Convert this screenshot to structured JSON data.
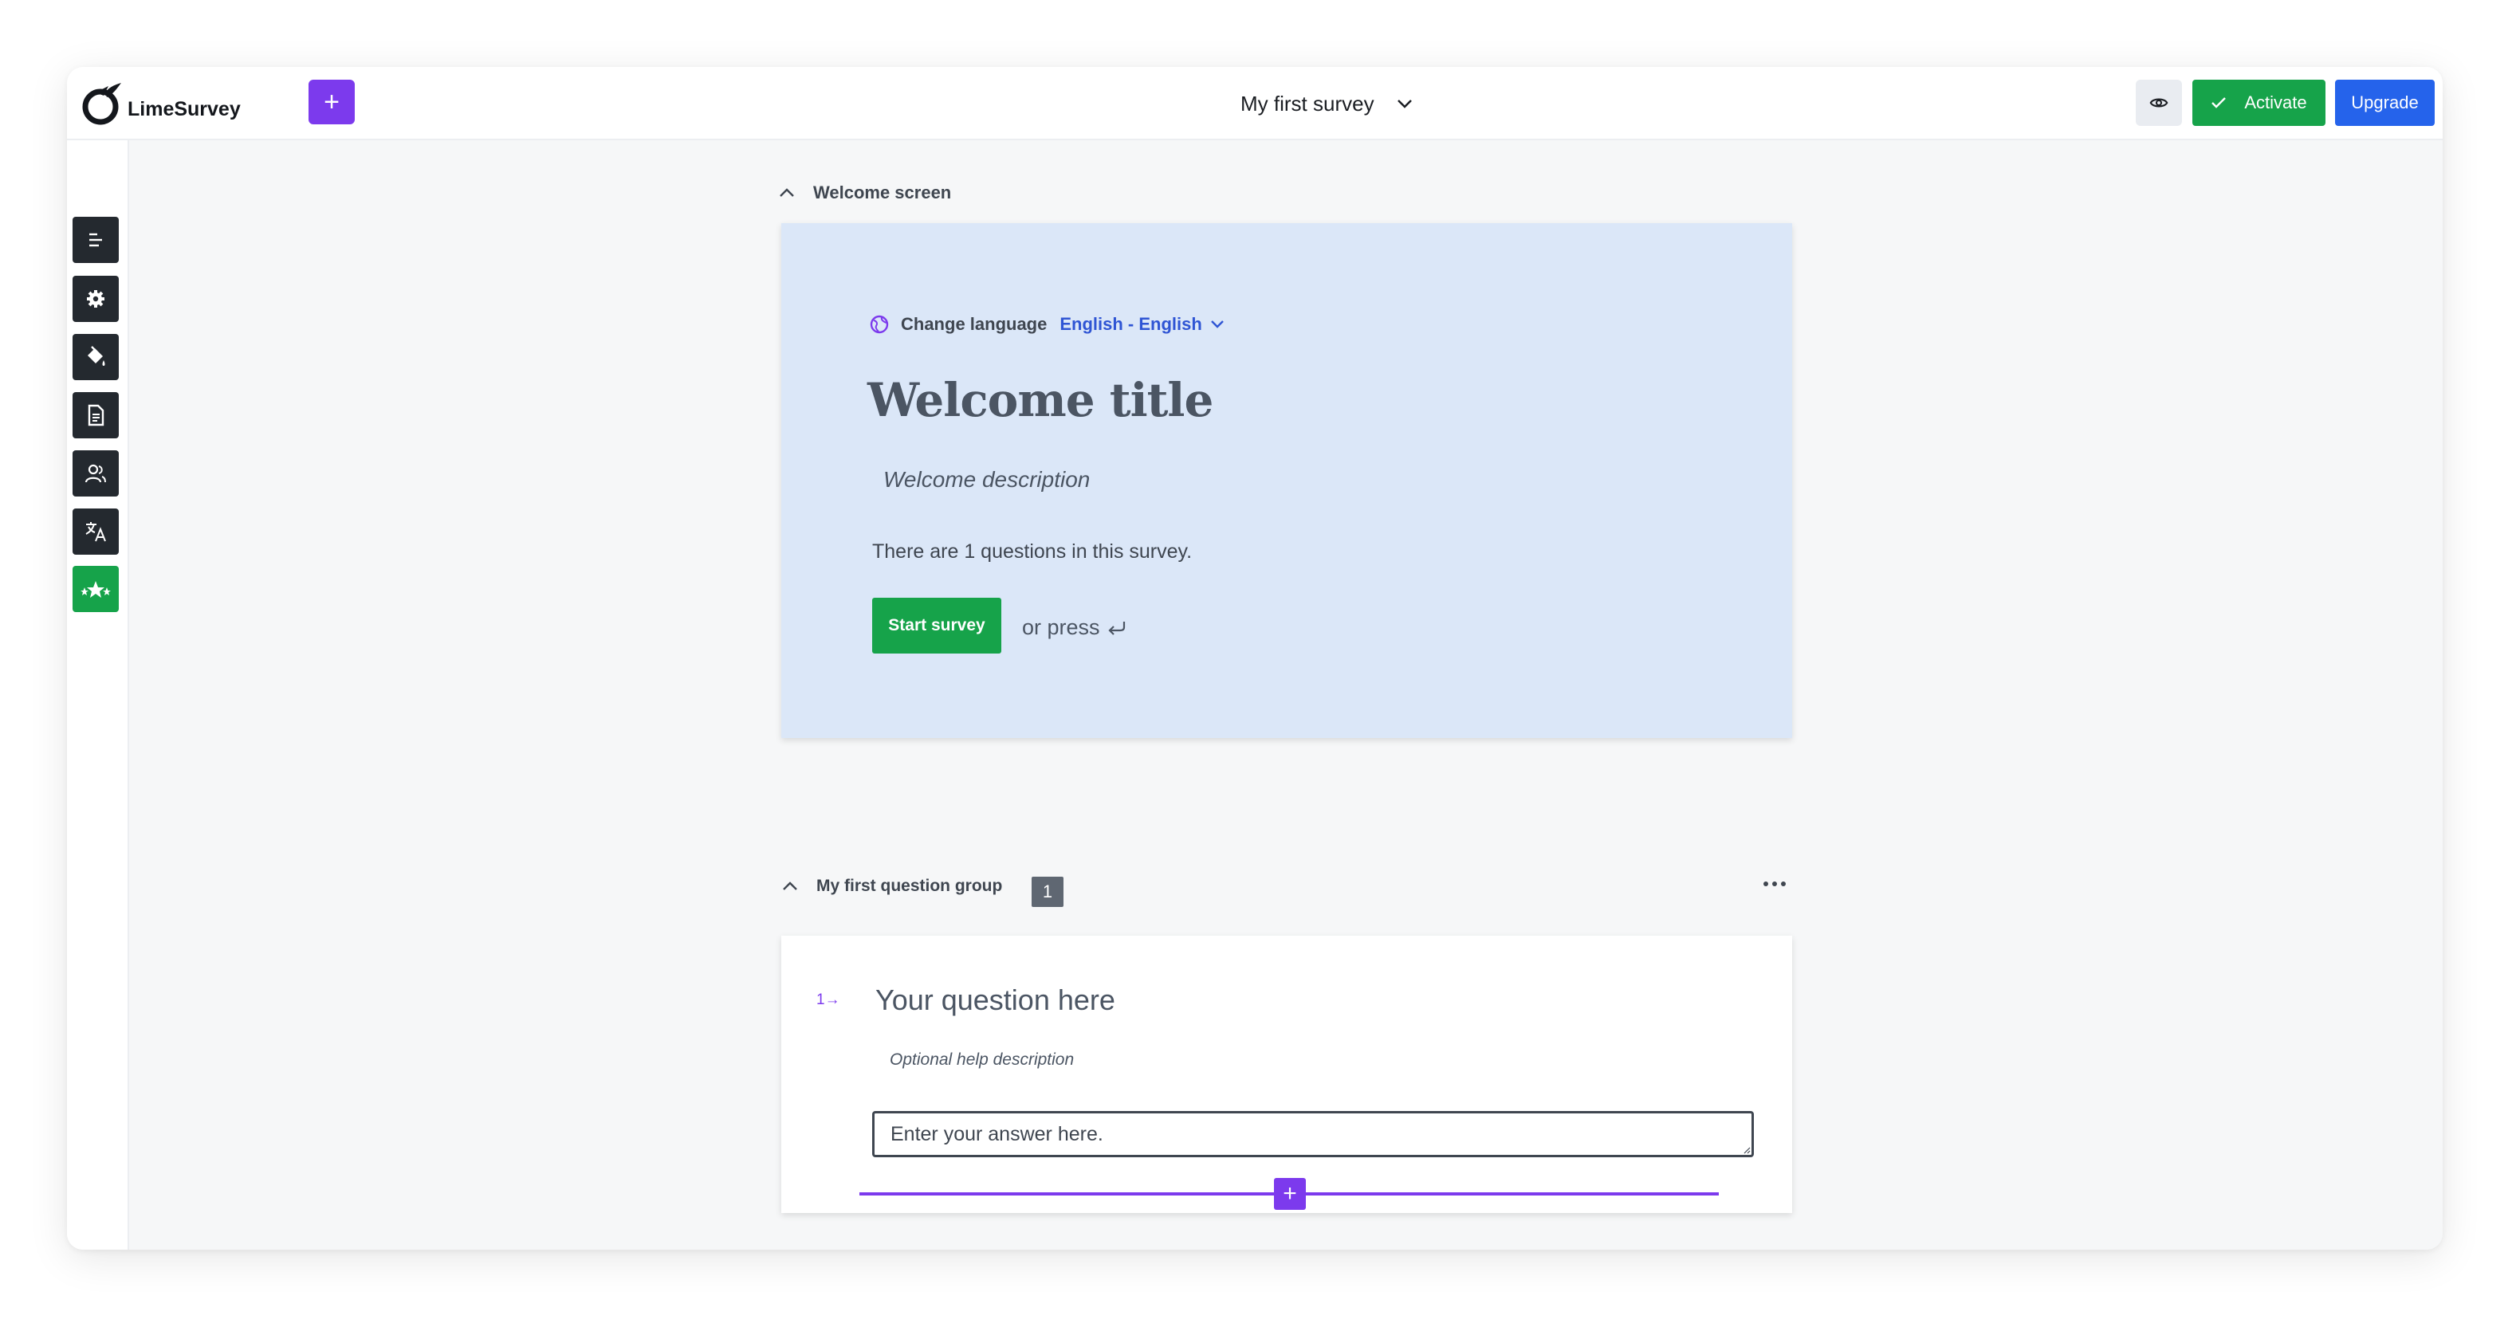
{
  "app": {
    "name": "LimeSurvey"
  },
  "header": {
    "add_button_label": "+",
    "survey_title": "My first survey",
    "activate_label": "Activate",
    "upgrade_label": "Upgrade"
  },
  "sidebar": {
    "items": [
      {
        "icon": "structure-icon"
      },
      {
        "icon": "settings-icon"
      },
      {
        "icon": "theme-icon"
      },
      {
        "icon": "document-icon"
      },
      {
        "icon": "participants-icon"
      },
      {
        "icon": "translate-icon"
      },
      {
        "icon": "rating-stars-icon"
      }
    ]
  },
  "welcome": {
    "section_label": "Welcome screen",
    "change_language_label": "Change language",
    "language_value": "English - English",
    "title": "Welcome title",
    "description": "Welcome description",
    "question_count_text": "There are 1 questions in this survey.",
    "start_button": "Start survey",
    "or_press_text": "or press"
  },
  "group": {
    "title": "My first question group",
    "badge": "1",
    "question": {
      "number": "1",
      "text": "Your question here",
      "help": "Optional help description",
      "placeholder": "Enter your answer here."
    }
  },
  "add_question_label": "+",
  "colors": {
    "accent_purple": "#7c3aed",
    "success_green": "#16a34a",
    "primary_blue": "#2563eb",
    "welcome_bg": "#dbe7f8"
  }
}
